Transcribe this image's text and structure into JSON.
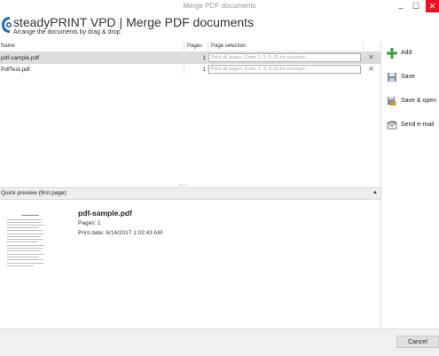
{
  "window": {
    "title": "Merge PDF documents",
    "minimize_glyph": "_",
    "maximize_glyph": "☐",
    "close_glyph": "✕"
  },
  "header": {
    "app_title": "steadyPRINT VPD | Merge PDF documents",
    "subtitle": "Arrange the documents by drag & drop",
    "logo_icon": "steadyprint-logo-icon"
  },
  "table": {
    "columns": {
      "name": "Name",
      "pages": "Pages",
      "selection": "Page selection"
    },
    "placeholder": "Print all pages. Enter 1, 3, 5-15 for example.",
    "remove_glyph": "✕",
    "rows": [
      {
        "name": "pdf-sample.pdf",
        "pages": "1",
        "selection": "",
        "selected": true
      },
      {
        "name": "PdfTest.pdf",
        "pages": "1",
        "selection": "",
        "selected": false
      }
    ]
  },
  "preview": {
    "header": "Quick preview (first page)",
    "collapse_glyph": "▲",
    "doc_title": "pdf-sample.pdf",
    "pages_text": "Pages: 1",
    "print_date_text": "Print date: 6/14/2017 1:02:43 AM"
  },
  "sidebar": {
    "actions": [
      {
        "label": "Add",
        "icon": "plus-icon",
        "color": "#3aa13a"
      },
      {
        "label": "Save",
        "icon": "save-icon",
        "color": "#7b8ea6"
      },
      {
        "label": "Save & open",
        "icon": "save-open-icon",
        "color": "#d19a3a"
      },
      {
        "label": "Send e-mail",
        "icon": "email-icon",
        "color": "#666666"
      }
    ]
  },
  "footer": {
    "cancel_label": "Cancel"
  },
  "colors": {
    "close_button": "#e81123",
    "selected_row": "#dcdcdc",
    "logo_blue": "#1f6db5"
  }
}
